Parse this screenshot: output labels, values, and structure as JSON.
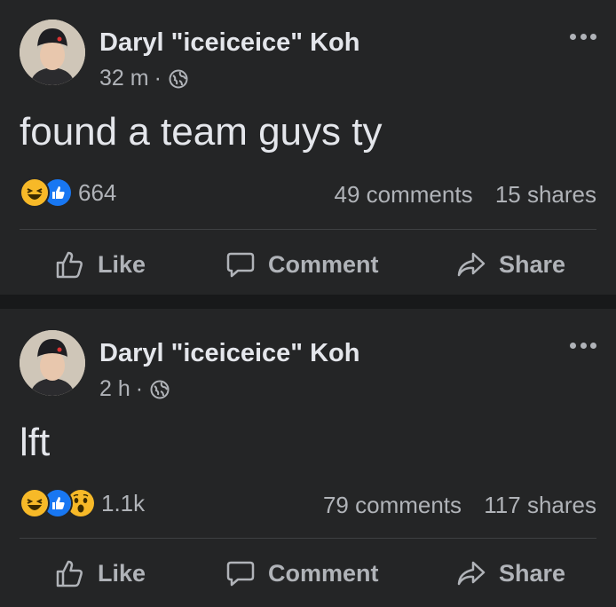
{
  "posts": [
    {
      "author": "Daryl \"iceiceice\" Koh",
      "time": "32 m",
      "separator": "·",
      "text": "found a team guys ty",
      "reaction_count": "664",
      "reactions": [
        "haha-icon",
        "like-icon"
      ],
      "comments": "49 comments",
      "shares": "15 shares"
    },
    {
      "author": "Daryl \"iceiceice\" Koh",
      "time": "2 h",
      "separator": "·",
      "text": "lft",
      "reaction_count": "1.1k",
      "reactions": [
        "haha-icon",
        "like-icon",
        "wow-icon"
      ],
      "comments": "79 comments",
      "shares": "117 shares"
    }
  ],
  "actions": {
    "like": "Like",
    "comment": "Comment",
    "share": "Share"
  },
  "colors": {
    "background": "#18191a",
    "card": "#242526",
    "primary_text": "#e4e6eb",
    "secondary_text": "#b0b3b8",
    "like_blue": "#1877f2",
    "reaction_yellow": "#f7b928"
  }
}
